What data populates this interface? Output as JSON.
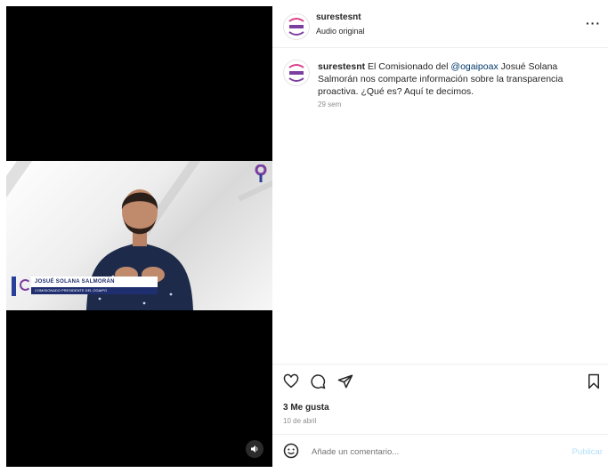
{
  "post": {
    "username": "surestesnt",
    "audio": "Audio original",
    "caption_user": "surestesnt",
    "caption_pre": " El Comisionado del ",
    "mention": "@ogaipoax",
    "caption_post": " Josué Solana Salmorán nos comparte información sobre la transparencia proactiva. ¿Qué es? Aquí te decimos.",
    "time_ago": "29 sem",
    "likes": "3 Me gusta",
    "date": "10 de abril"
  },
  "video": {
    "name_text": "JOSUÉ SOLANA SALMORÁN",
    "subtitle_text": "COMISIONADO PRESIDENTE DEL OGAIPO"
  },
  "comment_box": {
    "placeholder": "Añade un comentario...",
    "publish_label": "Publicar"
  },
  "icons": {
    "like": "heart-icon",
    "comment": "comment-icon",
    "share": "share-icon",
    "save": "bookmark-icon",
    "emoji": "emoji-icon",
    "volume": "volume-icon",
    "more": "more-options-icon"
  },
  "colors": {
    "mention": "#00376b",
    "publish": "#b2dffc",
    "brand_purple": "#7b3fa0",
    "brand_pink": "#d9428a"
  }
}
